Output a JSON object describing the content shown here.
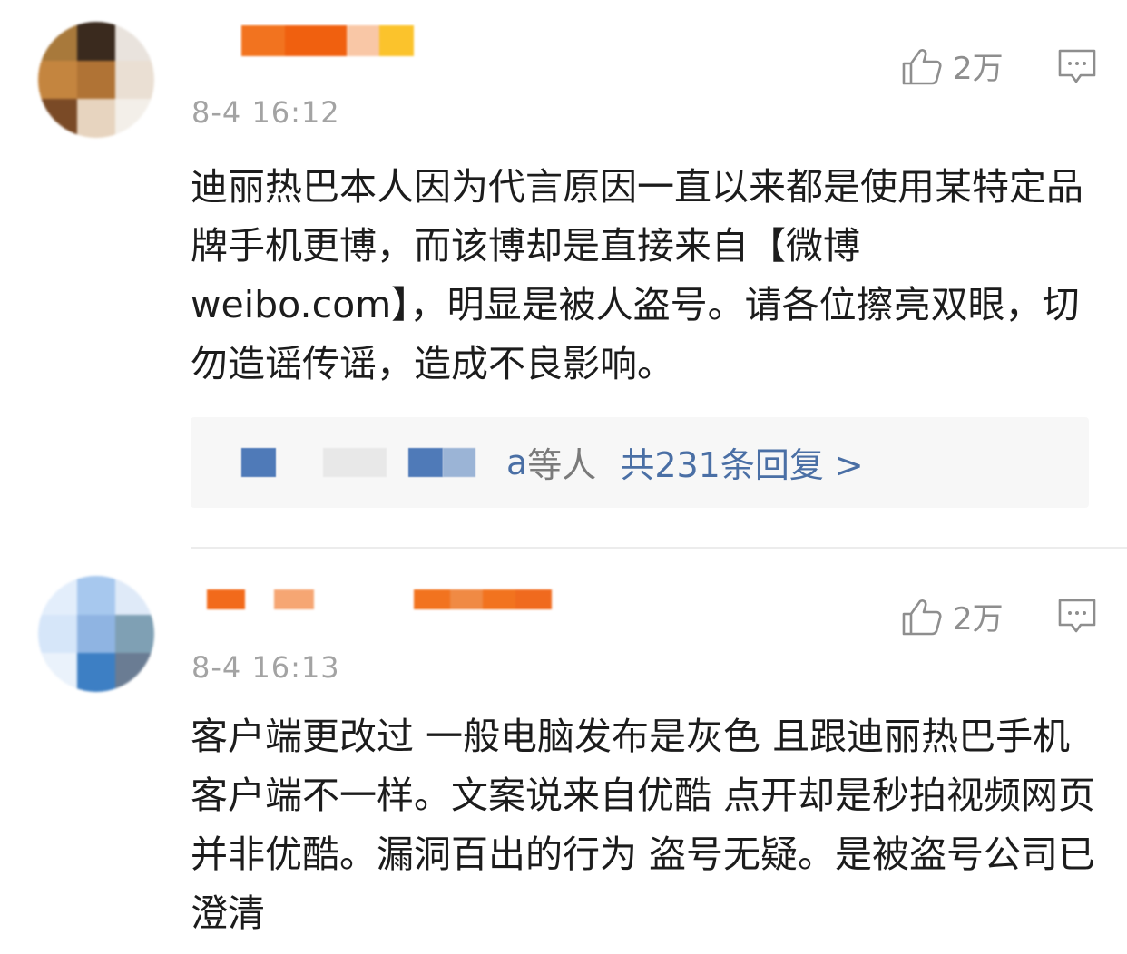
{
  "comments": [
    {
      "time": "8-4 16:12",
      "like_count": "2万",
      "text": "迪丽热巴本人因为代言原因一直以来都是使用某特定品牌手机更博，而该博却是直接来自【微博weibo.com】，明显是被人盗号。请各位擦亮双眼，切勿造谣传谣，造成不良影响。",
      "reply": {
        "partial_name": "a",
        "suffix": "等人",
        "count_label": "共231条回复 >"
      }
    },
    {
      "time": "8-4 16:13",
      "like_count": "2万",
      "text": "客户端更改过 一般电脑发布是灰色 且跟迪丽热巴手机客户端不一样。文案说来自优酷 点开却是秒拍视频网页并非优酷。漏洞百出的行为 盗号无疑。是被盗号公司已澄清"
    }
  ],
  "icons": {
    "like": "thumbs-up-icon",
    "comment": "comment-bubble-icon"
  },
  "colors": {
    "link": "#4a6fa5",
    "name_blur": "#f26a1b",
    "muted": "#a3a3a3"
  }
}
